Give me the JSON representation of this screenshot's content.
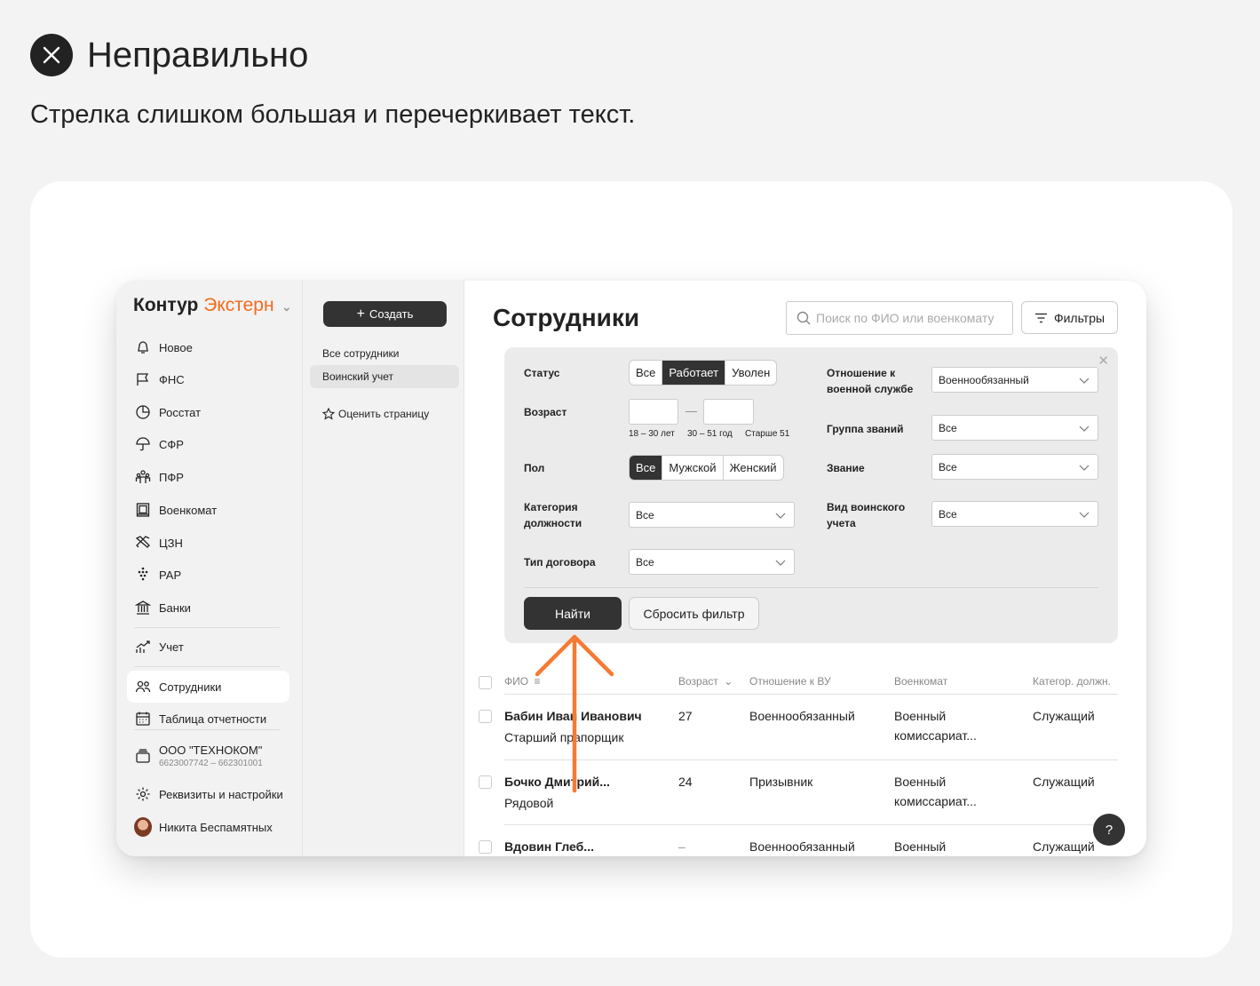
{
  "header": {
    "title": "Неправильно",
    "subtitle": "Стрелка слишком большая и перечеркивает текст."
  },
  "app": {
    "brand_main": "Контур",
    "brand_product": "Экстерн",
    "accent_color": "#f26b1d",
    "sidebar": {
      "items": [
        {
          "label": "Новое",
          "icon": "bell-icon"
        },
        {
          "label": "ФНС",
          "icon": "flag-icon"
        },
        {
          "label": "Росстат",
          "icon": "pie-chart-icon"
        },
        {
          "label": "СФР",
          "icon": "umbrella-icon"
        },
        {
          "label": "ПФР",
          "icon": "people-icon"
        },
        {
          "label": "Военкомат",
          "icon": "portrait-icon"
        },
        {
          "label": "ЦЗН",
          "icon": "tools-icon"
        },
        {
          "label": "РАР",
          "icon": "grapes-icon"
        },
        {
          "label": "Банки",
          "icon": "bank-icon"
        },
        {
          "label": "Учет",
          "icon": "chart-up-icon"
        },
        {
          "label": "Сотрудники",
          "icon": "users-icon"
        },
        {
          "label": "Таблица отчетности",
          "icon": "calendar-icon"
        }
      ],
      "org_name": "ООО \"ТЕХНОКОМ\"",
      "org_inn": "6623007742 – 662301001",
      "settings_label": "Реквизиты и настройки",
      "user_name": "Никита Беспамятных"
    },
    "subnav": {
      "create_label": "Создать",
      "links": [
        "Все сотрудники",
        "Воинский учет"
      ],
      "rate_label": "Оценить страницу"
    },
    "main": {
      "title": "Сотрудники",
      "search_placeholder": "Поиск по ФИО или военкомату",
      "filters_label": "Фильтры"
    },
    "filter": {
      "status_label": "Статус",
      "status_options": [
        "Все",
        "Работает",
        "Уволен"
      ],
      "status_selected": "Работает",
      "age_label": "Возраст",
      "age_dash": "—",
      "age_hints": [
        "18 – 30 лет",
        "30 – 51 год",
        "Старше 51"
      ],
      "gender_label": "Пол",
      "gender_options": [
        "Все",
        "Мужской",
        "Женский"
      ],
      "gender_selected": "Все",
      "category_label": "Категория должности",
      "category_value": "Все",
      "contract_label": "Тип договора",
      "contract_value": "Все",
      "military_label": "Отношение к военной службе",
      "military_value": "Военнообязанный",
      "rank_group_label": "Группа званий",
      "rank_group_value": "Все",
      "rank_label": "Звание",
      "rank_value": "Все",
      "record_type_label": "Вид воинского учета",
      "record_type_value": "Все",
      "find_label": "Найти",
      "reset_label": "Сбросить фильтр"
    },
    "table": {
      "columns": [
        "ФИО",
        "Возраст",
        "Отношение к ВУ",
        "Военкомат",
        "Категор. должн."
      ],
      "rows": [
        {
          "name": "Бабин Иван Иванович",
          "rank": "Старший прапорщик",
          "age": "27",
          "relation": "Военнообязанный",
          "office1": "Военный",
          "office2": "комиссариат...",
          "category": "Служащий"
        },
        {
          "name": "Бочко Дмитрий...",
          "rank": "Рядовой",
          "age": "24",
          "relation": "Призывник",
          "office1": "Военный",
          "office2": "комиссариат...",
          "category": "Служащий"
        },
        {
          "name": "Вдовин Глеб...",
          "rank": "",
          "age": "–",
          "relation": "Военнообязанный",
          "office1": "Военный",
          "office2": "",
          "category": "Служащий"
        }
      ]
    },
    "help_label": "?"
  },
  "arrow_color": "#f57a33"
}
